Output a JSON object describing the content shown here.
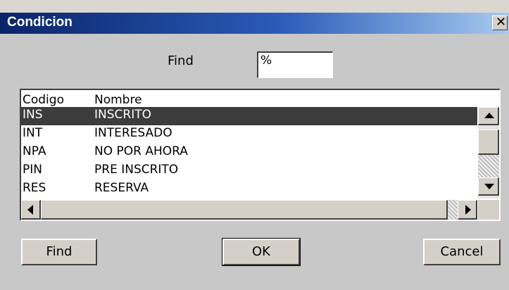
{
  "window": {
    "title": "Condicion",
    "close_symbol": "✕"
  },
  "find": {
    "label": "Find",
    "value": "%"
  },
  "list": {
    "columns": [
      "Codigo",
      "Nombre"
    ],
    "rows": [
      {
        "code": "INS",
        "name": "INSCRITO",
        "selected": true
      },
      {
        "code": "INT",
        "name": "INTERESADO",
        "selected": false
      },
      {
        "code": "NPA",
        "name": "NO POR AHORA",
        "selected": false
      },
      {
        "code": "PIN",
        "name": "PRE INSCRITO",
        "selected": false
      },
      {
        "code": "RES",
        "name": "RESERVA",
        "selected": false
      }
    ]
  },
  "buttons": {
    "find": "Find",
    "ok": "OK",
    "cancel": "Cancel"
  },
  "colors": {
    "selection": "#3c3c3c",
    "dialog_bg": "#c8c8c8",
    "title_start": "#0a246a",
    "title_end": "#a6caf0"
  }
}
